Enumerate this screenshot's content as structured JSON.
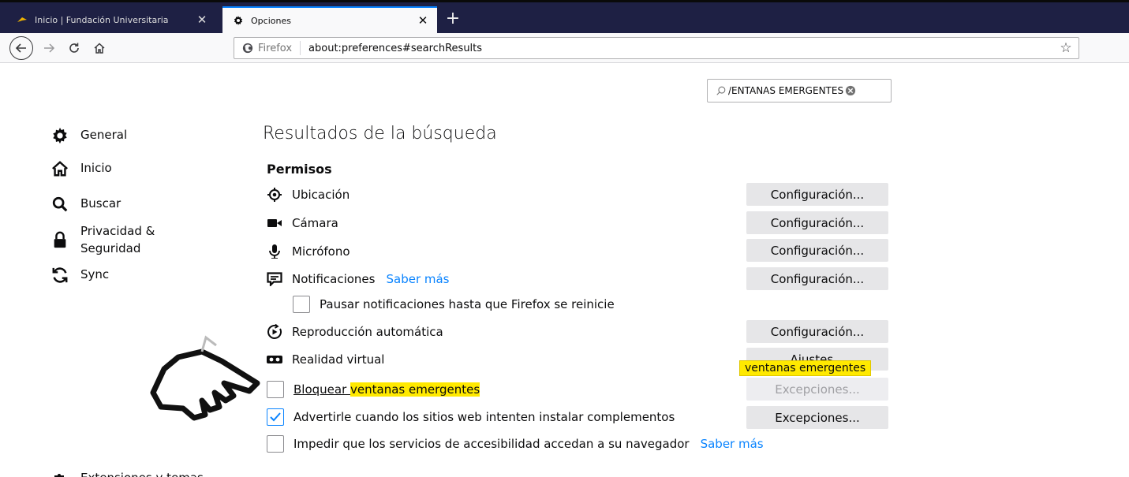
{
  "tabs": [
    {
      "title": "Inicio | Fundación Universitaria",
      "close": "✕"
    },
    {
      "title": "Opciones",
      "close": "✕"
    }
  ],
  "new_tab": "+",
  "nav": {
    "identity_label": "Firefox",
    "url": "about:preferences#searchResults"
  },
  "pref_search": {
    "value": "/ENTANAS EMERGENTES"
  },
  "sidebar": {
    "items": [
      {
        "label": "General",
        "icon": "gear-icon"
      },
      {
        "label": "Inicio",
        "icon": "home-icon"
      },
      {
        "label": "Buscar",
        "icon": "search-icon"
      },
      {
        "label": "Privacidad &\nSeguridad",
        "icon": "lock-icon"
      },
      {
        "label": "Sync",
        "icon": "sync-icon"
      }
    ],
    "extensions": "Extensiones y temas"
  },
  "main": {
    "title": "Resultados de la búsqueda",
    "section": "Permisos",
    "permissions": [
      {
        "label": "Ubicación",
        "button": "Configuración..."
      },
      {
        "label": "Cámara",
        "button": "Configuración..."
      },
      {
        "label": "Micrófono",
        "button": "Configuración..."
      },
      {
        "label": "Notificaciones",
        "link": "Saber más",
        "button": "Configuración..."
      },
      {
        "label": "Reproducción automática",
        "button": "Configuración..."
      },
      {
        "label": "Realidad virtual",
        "button": "Ajustes..."
      }
    ],
    "pause_notifications": "Pausar notificaciones hasta que Firefox se reinicie",
    "block_popups_prefix": "Bloquear ",
    "block_popups_highlight": "ventanas emergentes",
    "block_popups_button": "Excepciones...",
    "warn_addons": "Advertirle cuando los sitios web intenten instalar complementos",
    "warn_addons_button": "Excepciones...",
    "prevent_a11y": "Impedir que los servicios de accesibilidad accedan a su navegador",
    "prevent_a11y_link": "Saber más",
    "tooltip": "ventanas emergentes"
  },
  "colors": {
    "accent": "#0a84ff",
    "highlight": "#ffe900",
    "tabbar": "#1e2044"
  }
}
